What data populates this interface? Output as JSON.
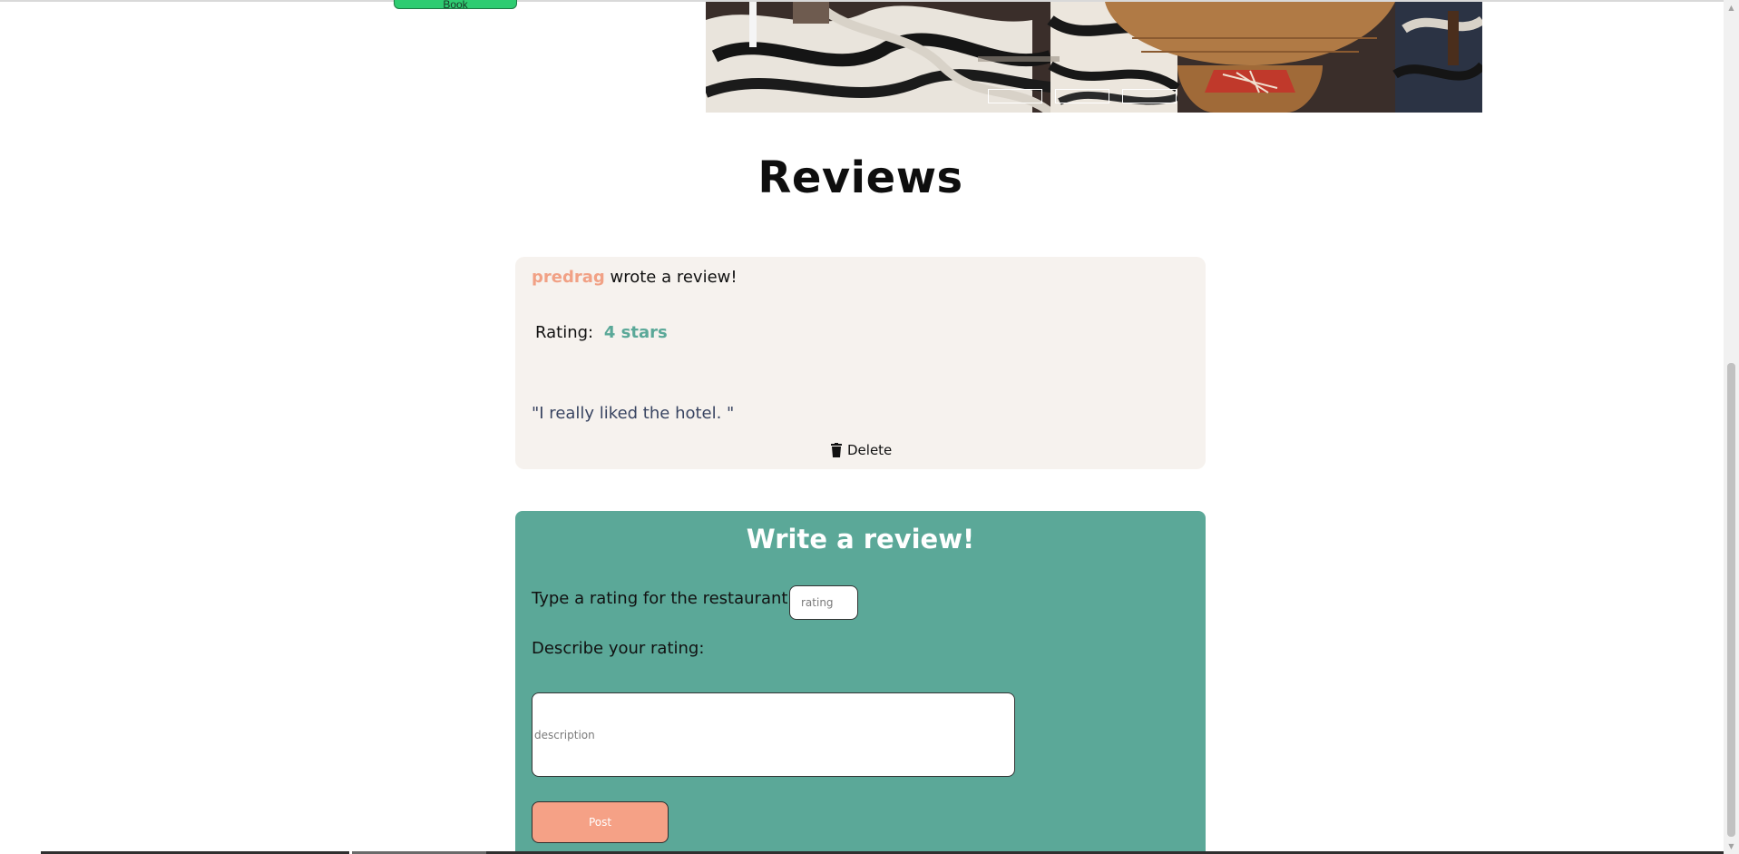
{
  "book_button": {
    "label": "Book"
  },
  "reviews": {
    "title": "Reviews",
    "items": [
      {
        "author": "predrag",
        "wrote_text": "wrote a review!",
        "rating_label": "Rating:",
        "rating_value": "4 stars",
        "text": "\"I really liked the hotel. \"",
        "delete_label": "Delete"
      }
    ]
  },
  "write_review": {
    "title": "Write a review!",
    "rating_label": "Type a rating for the restaurant:",
    "rating_placeholder": "rating",
    "describe_label": "Describe your rating:",
    "description_placeholder": "description",
    "post_label": "Post"
  },
  "colors": {
    "accent_green": "#5ba898",
    "accent_salmon": "#f5a186",
    "review_card_bg": "#f6f2ee",
    "book_green": "#2ecc71"
  },
  "icons": {
    "delete": "trash-icon"
  }
}
